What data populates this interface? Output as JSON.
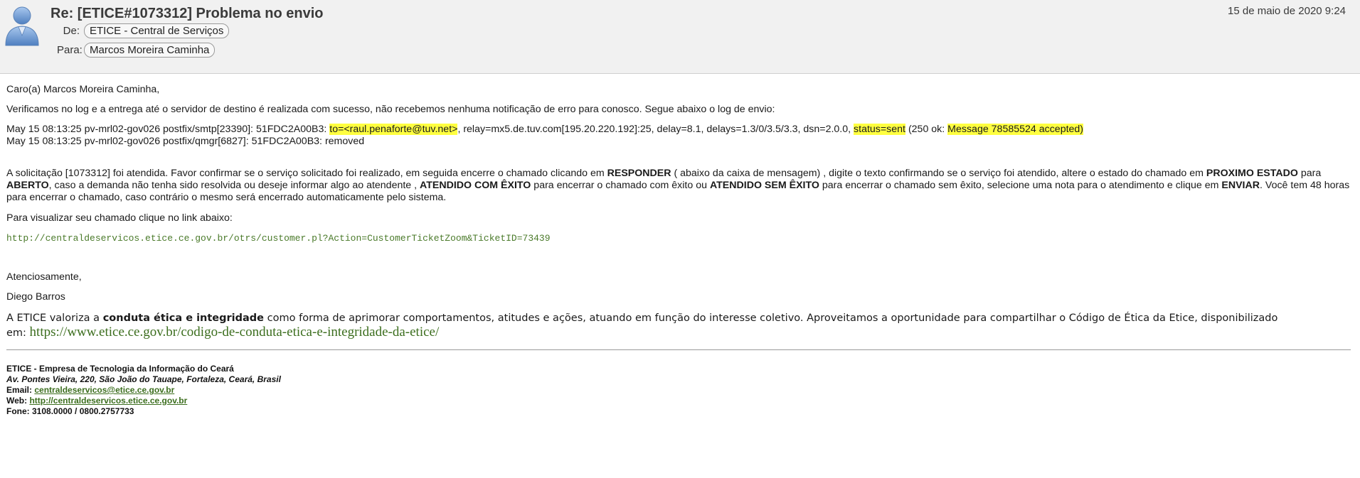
{
  "header": {
    "subject": "Re: [ETICE#1073312] Problema no envio",
    "date": "15 de maio de 2020 9:24",
    "from_label": "De:",
    "from": "ETICE - Central de Serviços",
    "to_label": "Para:",
    "to": "Marcos Moreira Caminha"
  },
  "body": {
    "greeting": "Caro(a) Marcos Moreira Caminha,",
    "intro": "Verificamos no log e a entrega até o servidor de destino é realizada com sucesso, não recebemos nenhuma notificação de erro para conosco. Segue abaixo o log de envio:",
    "log1": {
      "prefix": "May 15 08:13:25 pv-mrl02-gov026 postfix/smtp[23390]: 51FDC2A00B3: ",
      "to": "to=<raul.penaforte@tuv.net>",
      "middle": ", relay=mx5.de.tuv.com[195.20.220.192]:25, delay=8.1, delays=1.3/0/3.5/3.3, dsn=2.0.0, ",
      "status": "status=sent",
      "after_status": " (250 ok:  ",
      "accepted": "Message 78585524 accepted)"
    },
    "log2": "May 15 08:13:25 pv-mrl02-gov026 postfix/qmgr[6827]: 51FDC2A00B3: removed",
    "para": {
      "t1": "A solicitação [1073312] foi atendida. Favor confirmar se o serviço solicitado foi realizado, em seguida encerre o chamado clicando em ",
      "b1": "RESPONDER",
      "t2": " ( abaixo da caixa de mensagem) , digite o texto confirmando se o serviço foi atendido, altere o estado do chamado em ",
      "b2": "PROXIMO ESTADO",
      "t3": " para ",
      "b3": "ABERTO",
      "t4": ", caso a demanda não tenha sido resolvida ou deseje informar algo ao atendente , ",
      "b4": "ATENDIDO COM ÊXITO",
      "t5": " para encerrar o chamado com êxito ou ",
      "b5": "ATENDIDO SEM ÊXITO",
      "t6": " para encerrar o chamado sem êxito, selecione uma nota para o atendimento e clique em ",
      "b6": "ENVIAR",
      "t7": ". Você tem 48 horas para encerrar o chamado, caso contrário o mesmo será encerrado automaticamente pelo sistema."
    },
    "view_text": "Para visualizar seu chamado clique no link abaixo:",
    "ticket_link": "http://centraldeservicos.etice.ce.gov.br/otrs/customer.pl?Action=CustomerTicketZoom&TicketID=73439",
    "closing": "Atenciosamente,",
    "signature_name": "Diego Barros",
    "ethics": {
      "t1": "A ETICE valoriza a ",
      "b1": "conduta ética e integridade",
      "t2": " como forma de aprimorar comportamentos, atitudes e ações, atuando em função do interesse coletivo.  Aproveitamos a oportunidade para compartilhar o Código de Ética da Etice, disponibilizado em:  ",
      "link": "https://www.etice.ce.gov.br/codigo-de-conduta-etica-e-integridade-da-etice/"
    }
  },
  "footer": {
    "org": "ETICE - Empresa de Tecnologia da Informação do Ceará",
    "address": "Av. Pontes Vieira, 220, São João do Tauape, Fortaleza, Ceará, Brasil",
    "email_label": "Email: ",
    "email": "centraldeservicos@etice.ce.gov.br",
    "web_label": "Web: ",
    "web": "http://centraldeservicos.etice.ce.gov.br",
    "phone": "Fone: 3108.0000 / 0800.2757733"
  },
  "colors": {
    "highlight": "#ffff40",
    "link_green": "#3c6e1e",
    "header_bg": "#f1f1f1"
  },
  "icons": {
    "avatar": "person-avatar-icon"
  }
}
